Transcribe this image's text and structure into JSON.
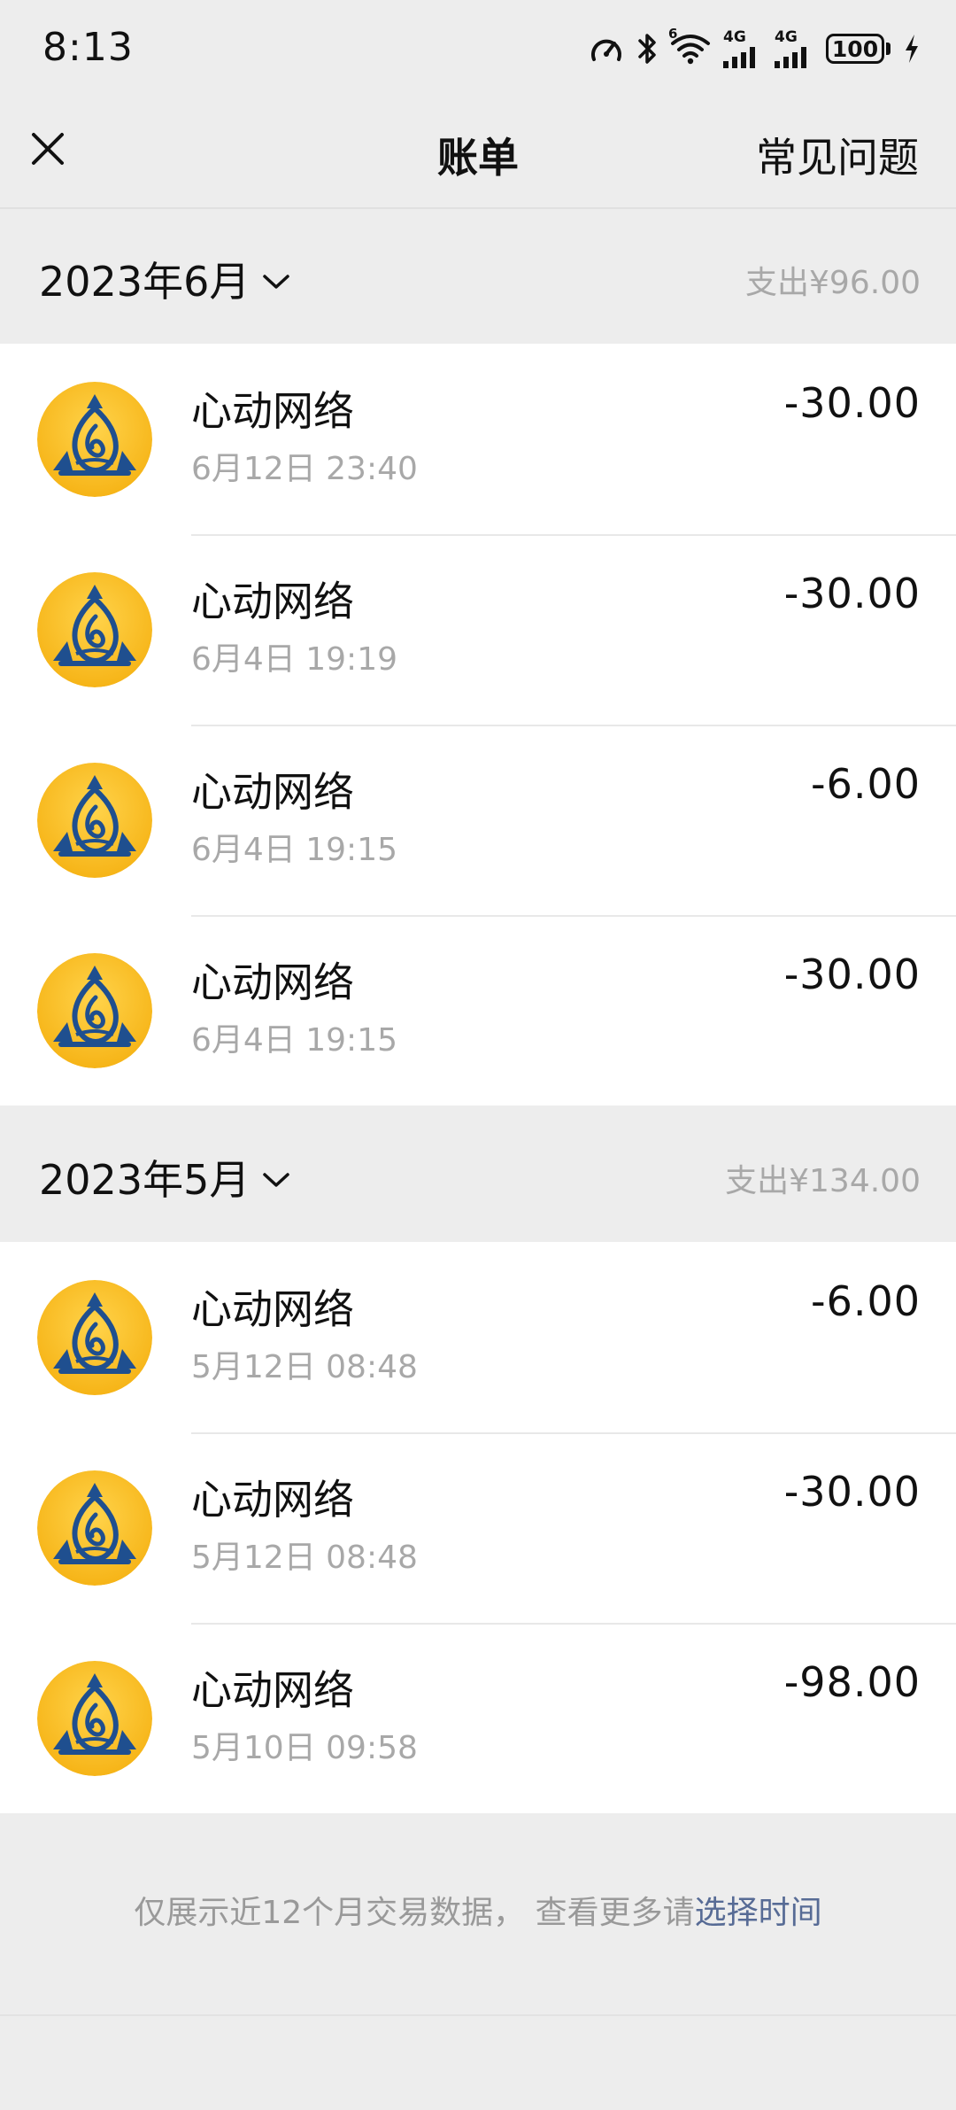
{
  "status_bar": {
    "time": "8:13",
    "network_1": "4G",
    "network_2": "4G",
    "wifi_badge": "6",
    "battery": "100"
  },
  "nav": {
    "title": "账单",
    "faq_label": "常见问题"
  },
  "groups": [
    {
      "month_label": "2023年6月",
      "expense_label": "支出¥96.00",
      "transactions": [
        {
          "merchant": "心动网络",
          "time": "6月12日 23:40",
          "amount": "-30.00"
        },
        {
          "merchant": "心动网络",
          "time": "6月4日 19:19",
          "amount": "-30.00"
        },
        {
          "merchant": "心动网络",
          "time": "6月4日 19:15",
          "amount": "-6.00"
        },
        {
          "merchant": "心动网络",
          "time": "6月4日 19:15",
          "amount": "-30.00"
        }
      ]
    },
    {
      "month_label": "2023年5月",
      "expense_label": "支出¥134.00",
      "transactions": [
        {
          "merchant": "心动网络",
          "time": "5月12日 08:48",
          "amount": "-6.00"
        },
        {
          "merchant": "心动网络",
          "time": "5月12日 08:48",
          "amount": "-30.00"
        },
        {
          "merchant": "心动网络",
          "time": "5月10日 09:58",
          "amount": "-98.00"
        }
      ]
    }
  ],
  "footer": {
    "note": "仅展示近12个月交易数据， 查看更多请",
    "link": "选择时间"
  },
  "colors": {
    "background": "#ededed",
    "card": "#ffffff",
    "secondary_text": "#a8a8a8",
    "link": "#576b95",
    "avatar_gold": "#f6b417",
    "avatar_blue": "#1f4f8f"
  },
  "icons": {
    "close": "close-icon",
    "month_dropdown": "chevron-down-icon",
    "merchant_logo": "merchant-logo-icon"
  }
}
